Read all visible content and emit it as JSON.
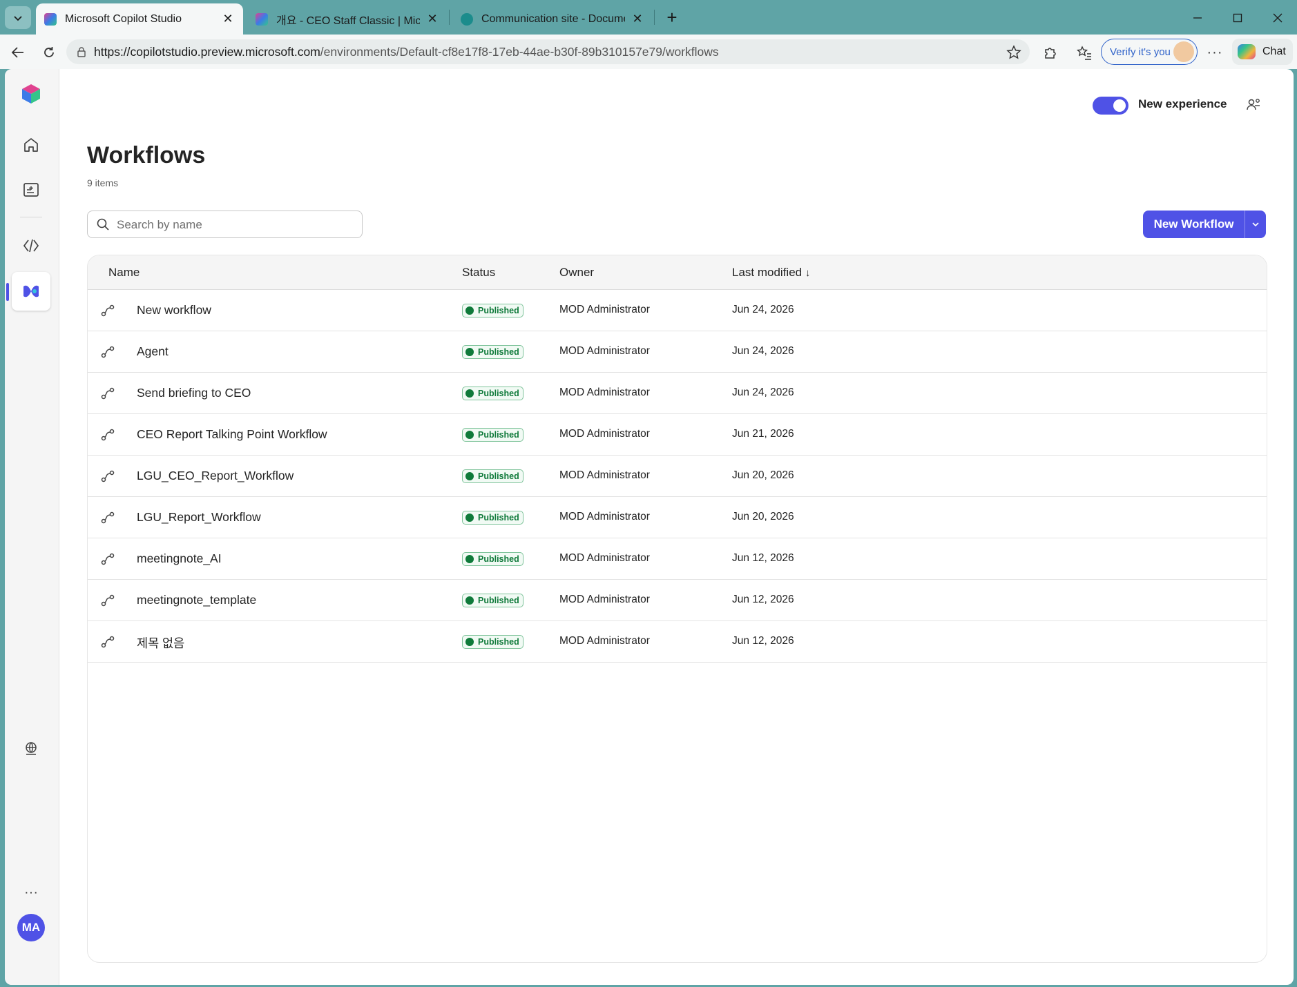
{
  "browser": {
    "tabs": [
      {
        "title": "Microsoft Copilot Studio",
        "active": true
      },
      {
        "title": "개요 - CEO Staff Classic | Microsoft",
        "active": false
      },
      {
        "title": "Communication site - Documents",
        "active": false
      }
    ],
    "url_host": "https://copilotstudio.preview.microsoft.com",
    "url_path": "/environments/Default-cf8e17f8-17eb-44ae-b30f-89b310157e79/workflows",
    "verify_label": "Verify it's you",
    "chat_label": "Chat"
  },
  "header": {
    "toggle_label": "New experience",
    "toggle_on": true
  },
  "page": {
    "title": "Workflows",
    "count": "9 items",
    "search_placeholder": "Search by name",
    "new_button_label": "New Workflow"
  },
  "table": {
    "columns": [
      "Name",
      "Status",
      "Owner",
      "Last modified"
    ],
    "sort_indicator": "↓",
    "rows": [
      {
        "name": "New workflow",
        "status": "Published",
        "owner": "MOD Administrator",
        "modified": "Jun 24, 2026"
      },
      {
        "name": "Agent",
        "status": "Published",
        "owner": "MOD Administrator",
        "modified": "Jun 24, 2026"
      },
      {
        "name": "Send briefing to CEO",
        "status": "Published",
        "owner": "MOD Administrator",
        "modified": "Jun 24, 2026"
      },
      {
        "name": "CEO Report Talking Point Workflow",
        "status": "Published",
        "owner": "MOD Administrator",
        "modified": "Jun 21, 2026"
      },
      {
        "name": "LGU_CEO_Report_Workflow",
        "status": "Published",
        "owner": "MOD Administrator",
        "modified": "Jun 20, 2026"
      },
      {
        "name": "LGU_Report_Workflow",
        "status": "Published",
        "owner": "MOD Administrator",
        "modified": "Jun 20, 2026"
      },
      {
        "name": "meetingnote_AI",
        "status": "Published",
        "owner": "MOD Administrator",
        "modified": "Jun 12, 2026"
      },
      {
        "name": "meetingnote_template",
        "status": "Published",
        "owner": "MOD Administrator",
        "modified": "Jun 12, 2026"
      },
      {
        "name": "제목 없음",
        "status": "Published",
        "owner": "MOD Administrator",
        "modified": "Jun 12, 2026"
      }
    ]
  },
  "sidebar": {
    "user_initials": "MA",
    "more_label": "···"
  },
  "colors": {
    "accent": "#4f52e6",
    "published": "#0f7a3a",
    "browser_frame": "#5fa4a6"
  }
}
